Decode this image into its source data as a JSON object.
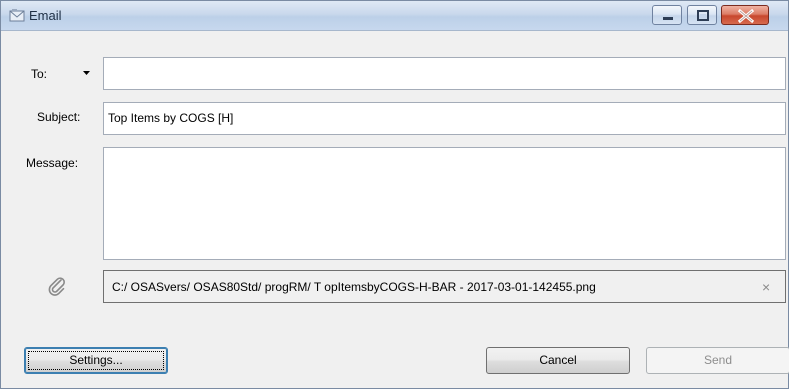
{
  "window": {
    "title": "Email",
    "icon": "email-envelope-icon",
    "controls": [
      "minimize-icon",
      "restore-icon",
      "close-icon"
    ]
  },
  "form": {
    "to_label": "To:",
    "to_value": "",
    "subject_label": "Subject:",
    "subject_value": "Top Items by COGS [H]",
    "message_label": "Message:",
    "message_value": ""
  },
  "attachment": {
    "icon": "paperclip-icon",
    "path": "C:/ OSASvers/ OSAS80Std/ progRM/ T opItemsbyCOGS-H-BAR - 2017-03-01-142455.png",
    "remove_glyph": "×"
  },
  "buttons": {
    "settings": "Settings...",
    "cancel": "Cancel",
    "send": "Send"
  },
  "colors": {
    "titlebar": "#c9d8ec",
    "close_button": "#c8472d",
    "focus_border": "#3c7fb1",
    "disabled_text": "#8d8d8d"
  }
}
